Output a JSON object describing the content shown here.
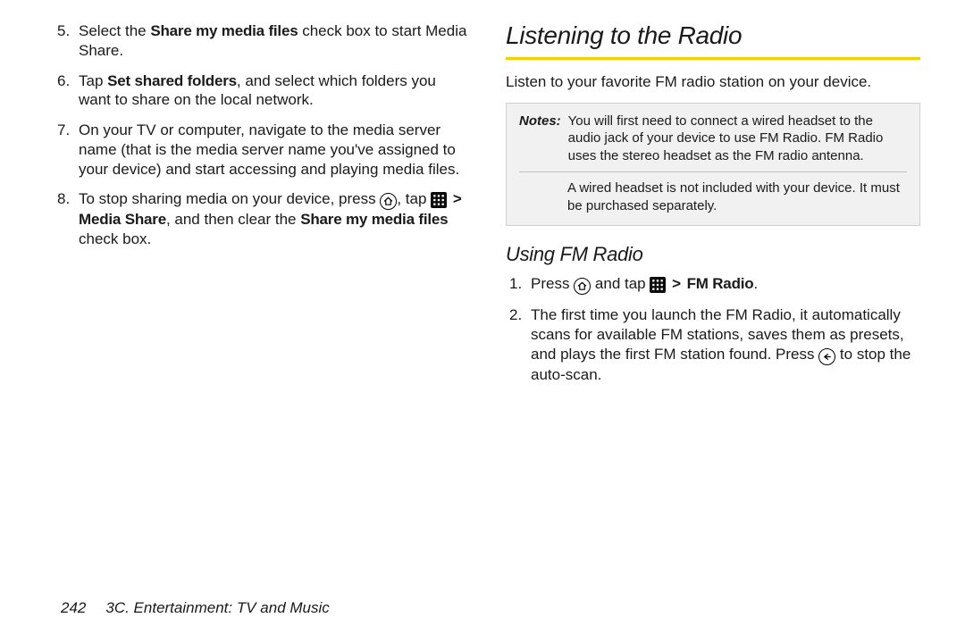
{
  "left": {
    "steps": {
      "s5a": "Select the ",
      "s5b": "Share my media files",
      "s5c": " check box to start Media Share.",
      "s6a": "Tap ",
      "s6b": "Set shared folders",
      "s6c": ", and select which folders you want to share on the local network.",
      "s7": "On your TV or computer, navigate to the media server name (that is the media server name you've assigned to your device) and start accessing and playing media files.",
      "s8a": "To stop sharing media on your device, press ",
      "s8b": ", tap ",
      "s8c": "Media Share",
      "s8d": ", and then clear the ",
      "s8e": "Share my media files",
      "s8f": " check box."
    }
  },
  "right": {
    "heading": "Listening to the Radio",
    "intro": "Listen to your favorite FM radio station on your device.",
    "notes": {
      "label": "Notes:",
      "p1": "You will first need to connect a wired headset to the audio jack of your device to use FM Radio. FM Radio uses the stereo headset as the FM radio antenna.",
      "p2": "A wired headset is not included with your device. It must be purchased separately."
    },
    "subheading": "Using FM Radio",
    "steps": {
      "s1a": "Press ",
      "s1b": " and tap ",
      "s1c": "FM Radio",
      "s1d": ".",
      "s2a": "The first time you launch the FM Radio, it automatically scans for available FM stations, saves them as presets, and plays the first FM station found. Press ",
      "s2b": " to stop the auto-scan."
    }
  },
  "footer": {
    "page": "242",
    "chapter": "3C. Entertainment: TV and Music"
  },
  "glyphs": {
    "gt": ">"
  }
}
